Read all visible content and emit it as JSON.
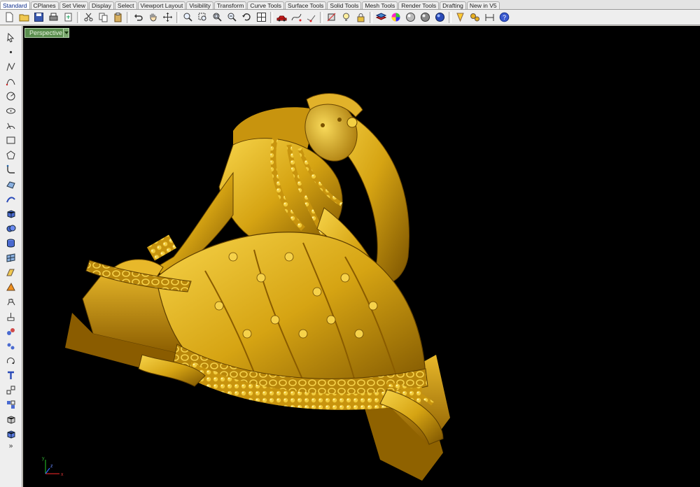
{
  "tabs": [
    {
      "label": "Standard",
      "active": true
    },
    {
      "label": "CPlanes",
      "active": false
    },
    {
      "label": "Set View",
      "active": false
    },
    {
      "label": "Display",
      "active": false
    },
    {
      "label": "Select",
      "active": false
    },
    {
      "label": "Viewport Layout",
      "active": false
    },
    {
      "label": "Visibility",
      "active": false
    },
    {
      "label": "Transform",
      "active": false
    },
    {
      "label": "Curve Tools",
      "active": false
    },
    {
      "label": "Surface Tools",
      "active": false
    },
    {
      "label": "Solid Tools",
      "active": false
    },
    {
      "label": "Mesh Tools",
      "active": false
    },
    {
      "label": "Render Tools",
      "active": false
    },
    {
      "label": "Drafting",
      "active": false
    },
    {
      "label": "New in V5",
      "active": false
    }
  ],
  "toolbar_icons": [
    "new-file-icon",
    "open-folder-icon",
    "save-icon",
    "print-icon",
    "import-icon",
    "cut-icon",
    "copy-icon",
    "paste-icon",
    "undo-icon",
    "pan-hand-icon",
    "move-icon",
    "zoom-in-icon",
    "zoom-window-icon",
    "zoom-extents-icon",
    "zoom-selected-icon",
    "rotate-view-icon",
    "four-viewports-icon",
    "car-icon",
    "select-curve-icon",
    "select-point-icon",
    "hide-object-icon",
    "light-bulb-icon",
    "lock-icon",
    "layer-icon",
    "color-wheel-icon",
    "material-sphere-icon",
    "render-sphere-icon",
    "blue-sphere-icon",
    "paint-cone-icon",
    "settings-gears-icon",
    "dimension-icon",
    "help-icon"
  ],
  "left_tools": [
    "select-arrow-icon",
    "point-icon",
    "polyline-icon",
    "curve-icon",
    "circle-icon",
    "ellipse-icon",
    "arc-icon",
    "rectangle-icon",
    "polygon-icon",
    "fillet-icon",
    "surface-icon",
    "sweep-icon",
    "box-solid-icon",
    "boolean-union-icon",
    "cylinder-icon",
    "mesh-icon",
    "transform-icon",
    "array-icon",
    "move-tool-icon",
    "extrude-icon",
    "group-icon",
    "join-icon",
    "rotate-icon",
    "text-icon",
    "scale-icon",
    "block-icon",
    "shade-cube-icon",
    "render-cube-icon"
  ],
  "left_more": "»",
  "viewport": {
    "name": "Perspective",
    "background": "#000000",
    "model_color": "#d6a413",
    "axis_labels": {
      "x": "x",
      "y": "y",
      "z": "z"
    }
  }
}
